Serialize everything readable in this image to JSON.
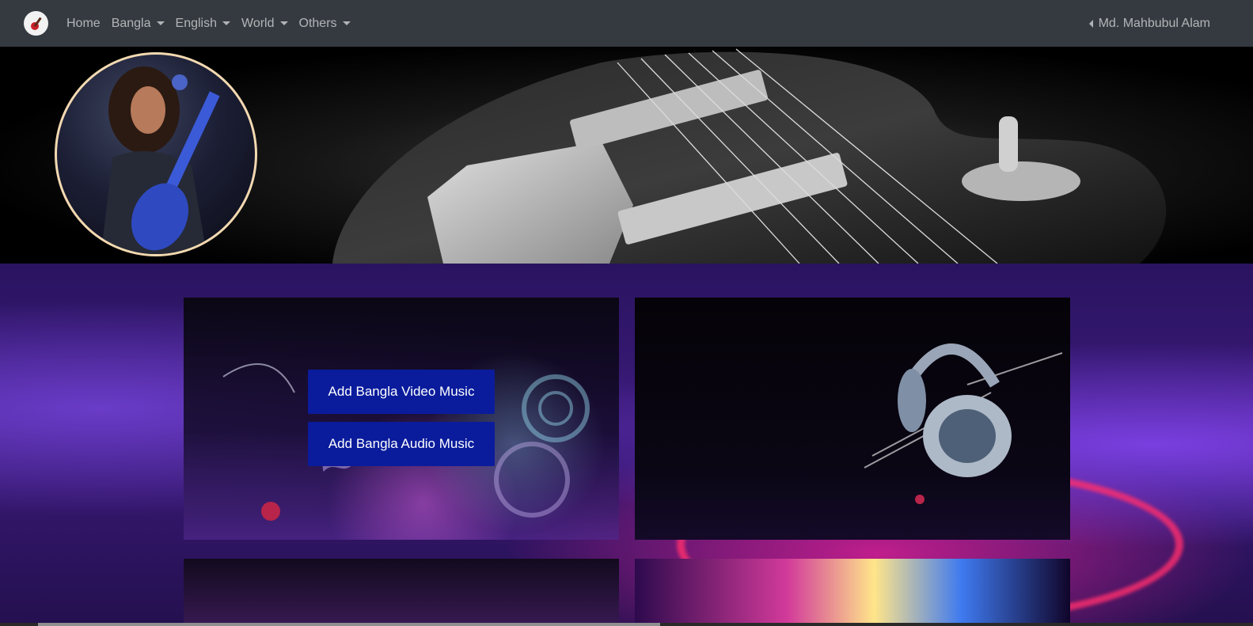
{
  "nav": {
    "home": "Home",
    "bangla": "Bangla",
    "english": "English",
    "world": "World",
    "others": "Others",
    "user": "Md. Mahbubul Alam"
  },
  "icons": {
    "brand": "guitar-logo-icon",
    "dropdown": "caret-down-icon",
    "user": "caret-left-icon"
  },
  "actions": {
    "add_video": "Add Bangla Video Music",
    "add_audio": "Add Bangla Audio Music"
  },
  "colors": {
    "navbar": "#343a40",
    "button": "#0a1c9c",
    "profile_border": "#f3d9b1"
  }
}
